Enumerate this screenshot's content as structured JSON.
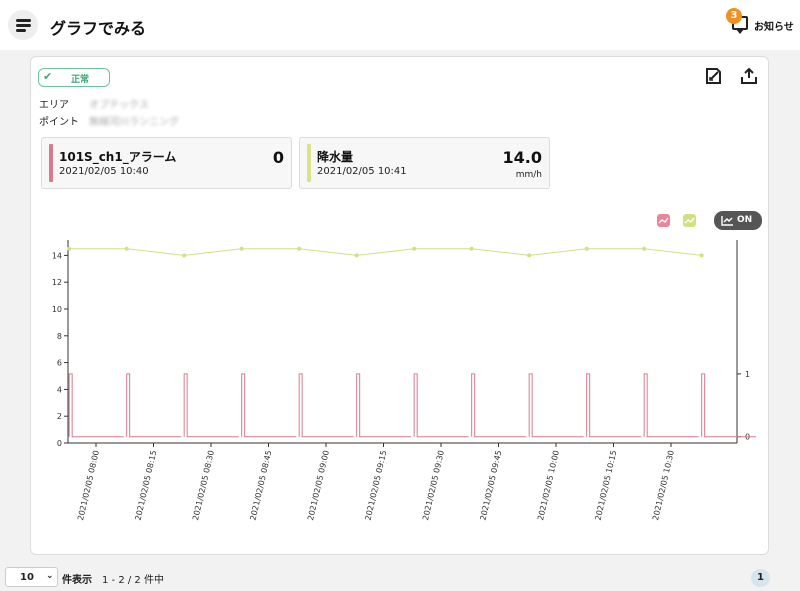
{
  "header": {
    "title": "グラフでみる",
    "notice_label": "お知らせ",
    "notice_count": "3"
  },
  "card": {
    "status": "正常",
    "area_label": "エリア",
    "area_value": "オプテックス",
    "point_label": "ポイント",
    "point_value": "無線河川ランニング"
  },
  "sensors": [
    {
      "name": "101S_ch1_アラーム",
      "time": "2021/02/05 10:40",
      "value": "0",
      "unit": "",
      "color": "#d9798e"
    },
    {
      "name": "降水量",
      "time": "2021/02/05 10:41",
      "value": "14.0",
      "unit": "mm/h",
      "color": "#dbe28a"
    }
  ],
  "legend": {
    "toggle_label": "ON",
    "series_colors": [
      "#e8879c",
      "#d4df84"
    ]
  },
  "chart_data": {
    "type": "line",
    "x_tick_labels": [
      "2021/02/05 08:00",
      "2021/02/05 08:15",
      "2021/02/05 08:30",
      "2021/02/05 08:45",
      "2021/02/05 09:00",
      "2021/02/05 09:15",
      "2021/02/05 09:30",
      "2021/02/05 09:45",
      "2021/02/05 10:00",
      "2021/02/05 10:15",
      "2021/02/05 10:30"
    ],
    "y_left": {
      "ticks": [
        0,
        2,
        4,
        6,
        8,
        10,
        12,
        14
      ],
      "range": [
        0,
        15
      ]
    },
    "y_right": {
      "ticks": [
        0,
        1
      ],
      "range": [
        -0.1,
        3.1
      ]
    },
    "series": [
      {
        "axis": "left",
        "color": "#d4df84",
        "x": [
          "07:53",
          "08:08",
          "08:23",
          "08:38",
          "08:53",
          "09:08",
          "09:23",
          "09:38",
          "09:53",
          "10:08",
          "10:23",
          "10:38"
        ],
        "values": [
          14.5,
          14.5,
          14.0,
          14.5,
          14.5,
          14.0,
          14.5,
          14.5,
          14.0,
          14.5,
          14.5,
          14.0
        ]
      },
      {
        "axis": "right",
        "color": "#d9798e",
        "pulse_times": [
          "07:53",
          "08:08",
          "08:23",
          "08:38",
          "08:53",
          "09:08",
          "09:23",
          "09:38",
          "09:53",
          "10:08",
          "10:23",
          "10:38"
        ],
        "baseline": 0,
        "peak": 1
      }
    ],
    "grid": false
  },
  "footer": {
    "per_page": "10",
    "per_page_label": "件表示",
    "count_label": "1 - 2 / 2 件中",
    "page": "1"
  }
}
